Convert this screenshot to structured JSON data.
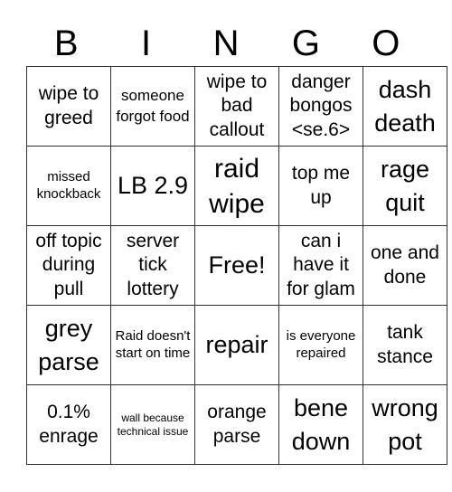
{
  "header": {
    "letters": [
      "B",
      "I",
      "N",
      "G",
      "O"
    ]
  },
  "board": {
    "rows": [
      [
        "wipe to greed",
        "someone forgot food",
        "wipe to bad callout",
        "danger bongos <se.6>",
        "dash death"
      ],
      [
        "missed knockback",
        "LB 2.9",
        "raid wipe",
        "top me up",
        "rage quit"
      ],
      [
        "off topic during pull",
        "server tick lottery",
        "Free!",
        "can i have it for glam",
        "one and done"
      ],
      [
        "grey parse",
        "Raid doesn't start on time",
        "repair",
        "is everyone repaired",
        "tank stance"
      ],
      [
        "0.1% enrage",
        "wall because technical issue",
        "orange parse",
        "bene down",
        "wrong pot"
      ]
    ],
    "free_space": "Free!"
  }
}
